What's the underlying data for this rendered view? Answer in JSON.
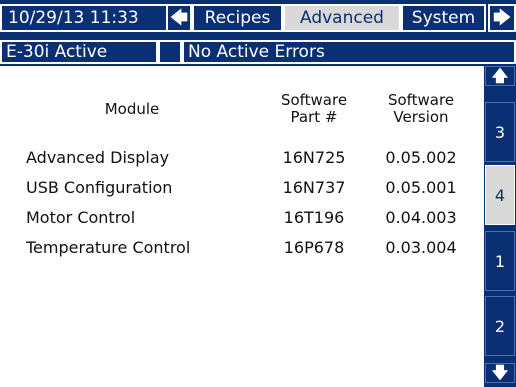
{
  "header": {
    "datetime": "10/29/13 11:33",
    "left_arrow": "🡄",
    "tabs": [
      "Recipes",
      "Advanced",
      "System"
    ],
    "right_arrow": "🡆",
    "active_tab": "Advanced"
  },
  "status": {
    "machine": "E-30i Active",
    "errors": "No Active Errors"
  },
  "table": {
    "headers": {
      "module": "Module",
      "part_line1": "Software",
      "part_line2": "Part #",
      "version_line1": "Software",
      "version_line2": "Version"
    },
    "rows": [
      {
        "module": "Advanced Display",
        "part": "16N725",
        "version": "0.05.002"
      },
      {
        "module": "USB Configuration",
        "part": "16N737",
        "version": "0.05.001"
      },
      {
        "module": "Motor Control",
        "part": "16T196",
        "version": "0.04.003"
      },
      {
        "module": "Temperature Control",
        "part": "16P678",
        "version": "0.03.004"
      }
    ]
  },
  "side_nav": {
    "up": "🡅",
    "pages": [
      "3",
      "4",
      "1",
      "2"
    ],
    "active_page": "4",
    "down": "🡇"
  },
  "colors": {
    "frame": "#0b2f73",
    "active": "#d9d9d9",
    "content_bg": "#ffffff"
  }
}
